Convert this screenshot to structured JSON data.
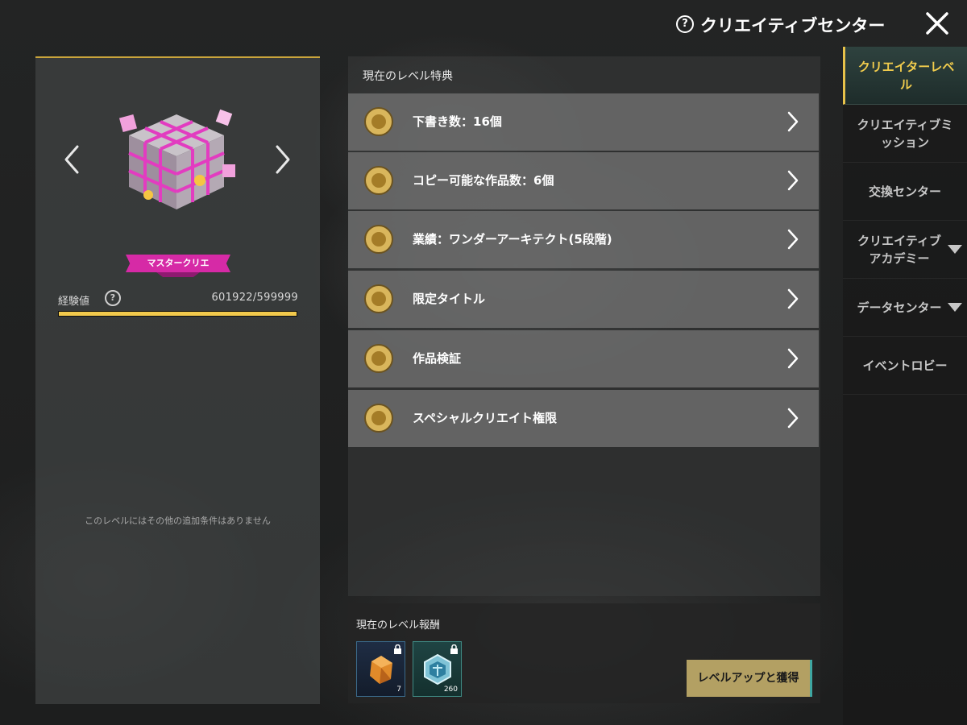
{
  "header": {
    "title": "クリエイティブセンター",
    "help_icon": "question-circle-icon",
    "close_icon": "close-icon"
  },
  "level_card": {
    "rank_name": "マスタークリエ",
    "xp_label": "経験値",
    "xp_value": "601922/599999",
    "xp_progress": 1.0,
    "no_conditions_text": "このレベルにはその他の追加条件はありません",
    "accent_color": "#d62aa6",
    "bar_color": "#f2c94c"
  },
  "benefits": {
    "title": "現在のレベル特典",
    "items": [
      {
        "label": "下書き数：16個",
        "icon": "draft-icon"
      },
      {
        "label": "コピー可能な作品数：6個",
        "icon": "copy-icon"
      },
      {
        "label": "業績：ワンダーアーキテクト(5段階)",
        "icon": "achievement-icon"
      },
      {
        "label": "限定タイトル",
        "icon": "title-badge-icon"
      },
      {
        "label": "作品検証",
        "icon": "thumbs-up-icon"
      },
      {
        "label": "スペシャルクリエイト権限",
        "icon": "location-pin-icon"
      }
    ]
  },
  "rewards": {
    "title": "現在のレベル報酬",
    "items": [
      {
        "count": "7",
        "icon": "orange-crystal-icon",
        "locked": true
      },
      {
        "count": "260",
        "icon": "blue-cube-icon",
        "locked": true
      }
    ],
    "button_label": "レベルアップと獲得"
  },
  "side_menu": {
    "items": [
      {
        "label": "クリエイターレベル",
        "active": true
      },
      {
        "label": "クリエイティブミッション",
        "active": false
      },
      {
        "label": "交換センター",
        "active": false
      },
      {
        "label": "クリエイティブアカデミー",
        "active": false,
        "has_dropdown": true
      },
      {
        "label": "データセンター",
        "active": false,
        "has_dropdown": true
      },
      {
        "label": "イベントロビー",
        "active": false
      }
    ],
    "active_color": "#f2cd4d"
  }
}
